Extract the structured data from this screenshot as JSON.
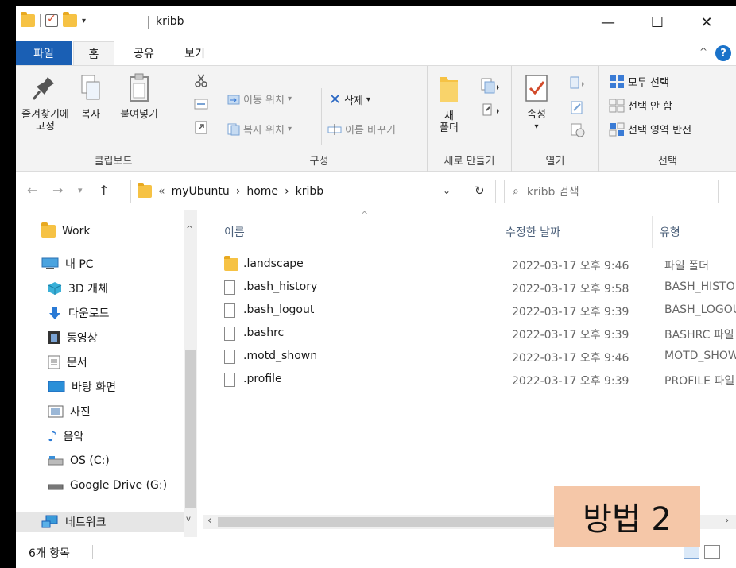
{
  "title": "kribb",
  "window_controls": {
    "minimize": "—",
    "maximize": "☐",
    "close": "✕"
  },
  "tabs": {
    "file": "파일",
    "home": "홈",
    "share": "공유",
    "view": "보기"
  },
  "ribbon": {
    "clipboard": {
      "label": "클립보드",
      "pin": "즐겨찾기에\n고정",
      "copy": "복사",
      "paste": "붙여넣기"
    },
    "organize": {
      "label": "구성",
      "move_to": "이동 위치",
      "copy_to": "복사 위치",
      "delete": "삭제",
      "rename": "이름 바꾸기"
    },
    "new": {
      "label": "새로 만들기",
      "new_folder": "새\n폴더"
    },
    "open": {
      "label": "열기",
      "properties": "속성"
    },
    "select": {
      "label": "선택",
      "select_all": "모두 선택",
      "select_none": "선택 안 함",
      "invert": "선택 영역 반전"
    }
  },
  "address": {
    "prefix": "«",
    "crumbs": [
      "myUbuntu",
      "home",
      "kribb"
    ],
    "separator": "›",
    "search_placeholder": "kribb 검색"
  },
  "nav": [
    {
      "label": "Work",
      "icon": "folder-icon"
    },
    {
      "label": "내 PC",
      "icon": "pc-icon"
    },
    {
      "label": "3D 개체",
      "icon": "cube-icon"
    },
    {
      "label": "다운로드",
      "icon": "download-icon"
    },
    {
      "label": "동영상",
      "icon": "video-icon"
    },
    {
      "label": "문서",
      "icon": "document-icon"
    },
    {
      "label": "바탕 화면",
      "icon": "desktop-icon"
    },
    {
      "label": "사진",
      "icon": "picture-icon"
    },
    {
      "label": "음악",
      "icon": "music-icon"
    },
    {
      "label": "OS (C:)",
      "icon": "drive-icon"
    },
    {
      "label": "Google Drive (G:)",
      "icon": "drive-icon"
    },
    {
      "label": "네트워크",
      "icon": "network-icon"
    }
  ],
  "columns": {
    "name": "이름",
    "modified": "수정한 날짜",
    "type": "유형"
  },
  "files": [
    {
      "name": ".landscape",
      "date": "2022-03-17 오후 9:46",
      "type": "파일 폴더",
      "folder": true
    },
    {
      "name": ".bash_history",
      "date": "2022-03-17 오후 9:58",
      "type": "BASH_HISTORY",
      "folder": false
    },
    {
      "name": ".bash_logout",
      "date": "2022-03-17 오후 9:39",
      "type": "BASH_LOGOUT",
      "folder": false
    },
    {
      "name": ".bashrc",
      "date": "2022-03-17 오후 9:39",
      "type": "BASHRC 파일",
      "folder": false
    },
    {
      "name": ".motd_shown",
      "date": "2022-03-17 오후 9:46",
      "type": "MOTD_SHOWN",
      "folder": false
    },
    {
      "name": ".profile",
      "date": "2022-03-17 오후 9:39",
      "type": "PROFILE 파일",
      "folder": false
    }
  ],
  "status": {
    "count": "6개 항목"
  },
  "overlay": {
    "text": "방법 2"
  },
  "colors": {
    "accent": "#1a5fb4",
    "folder": "#f6c244",
    "overlay": "#f5c7a8"
  }
}
